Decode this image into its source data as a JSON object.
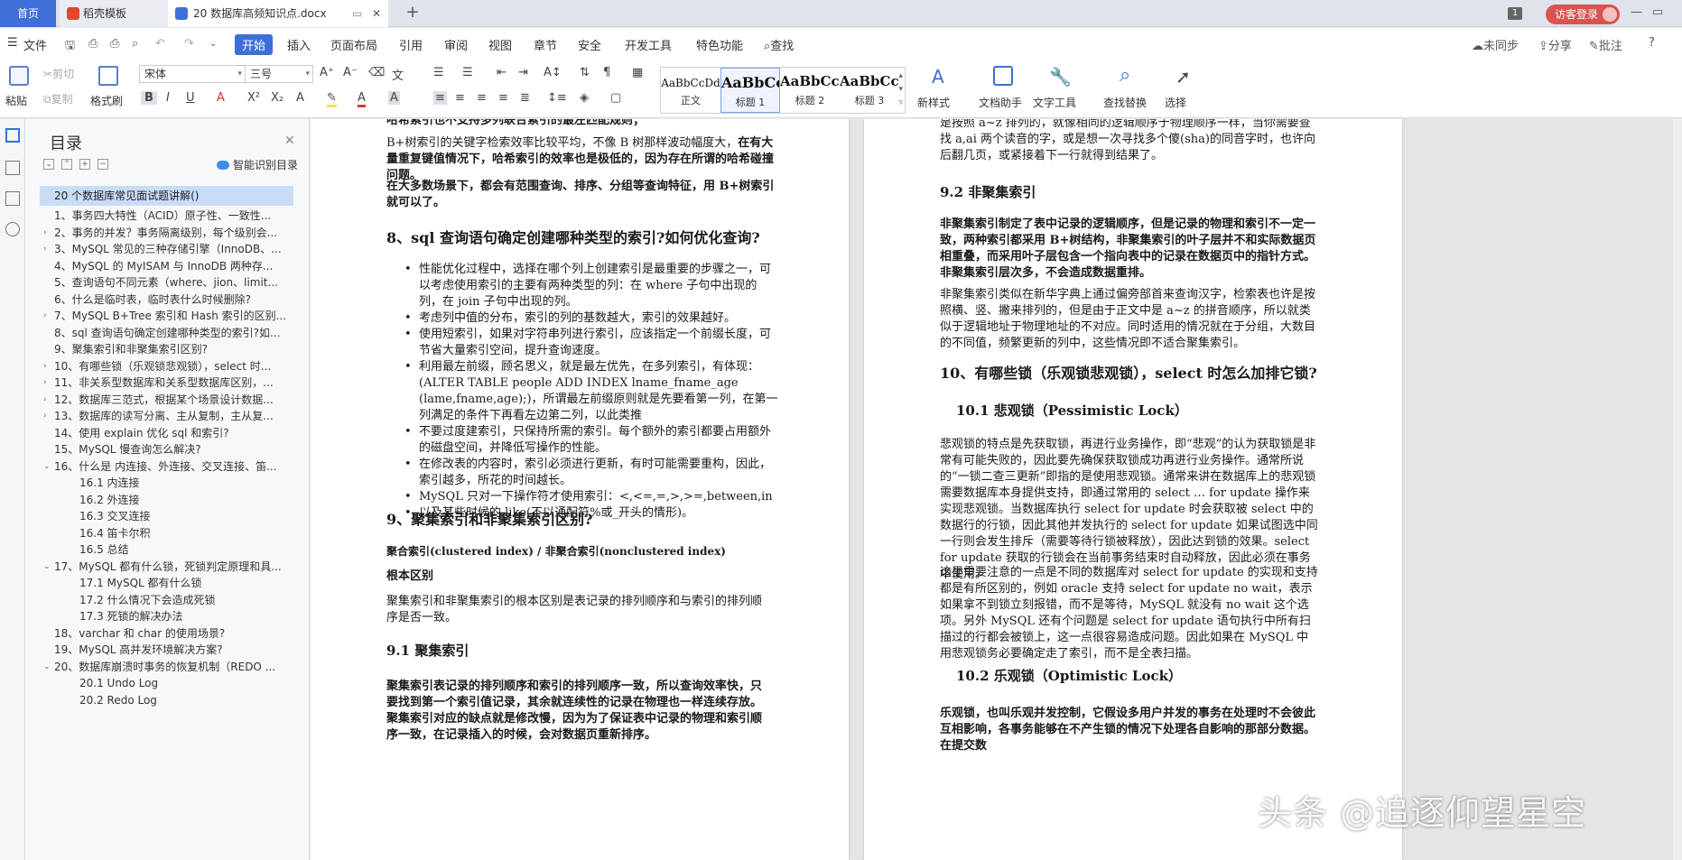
{
  "tabs": {
    "home": "首页",
    "templates": "稻壳模板",
    "document": "20 数据库高频知识点.docx",
    "badge": "1",
    "login": "访客登录"
  },
  "menu": {
    "file": "文件",
    "items": [
      "开始",
      "插入",
      "页面布局",
      "引用",
      "审阅",
      "视图",
      "章节",
      "安全",
      "开发工具",
      "特色功能"
    ],
    "search": "查找",
    "right": [
      "未同步",
      "分享",
      "批注",
      "?"
    ]
  },
  "ribbon": {
    "paste": "粘贴",
    "cut": "剪切",
    "copy": "复制",
    "format_painter": "格式刷",
    "font_name": "宋体",
    "font_size": "三号",
    "styles": [
      {
        "preview": "AaBbCcDd",
        "name": "正文"
      },
      {
        "preview": "AaBbCc",
        "name": "标题 1"
      },
      {
        "preview": "AaBbCcI",
        "name": "标题 2"
      },
      {
        "preview": "AaBbCcI",
        "name": "标题 3"
      }
    ],
    "new_style": "新样式",
    "doc_helper": "文档助手",
    "text_tools": "文字工具",
    "find_replace": "查找替换",
    "select": "选择"
  },
  "nav": {
    "title": "目录",
    "smart": "智能识别目录",
    "selected": "20 个数据库常见面试题讲解()",
    "items": [
      {
        "text": "1、事务四大特性（ACID）原子性、一致性...",
        "level": 1,
        "arrow": ""
      },
      {
        "text": "2、事务的并发？事务隔离级别，每个级别会...",
        "level": 1,
        "arrow": "›"
      },
      {
        "text": "3、MySQL 常见的三种存储引擎（InnoDB、...",
        "level": 1,
        "arrow": "›"
      },
      {
        "text": "4、MySQL 的 MyISAM 与 InnoDB 两种存...",
        "level": 1,
        "arrow": ""
      },
      {
        "text": "5、查询语句不同元素（where、jion、limit...",
        "level": 1,
        "arrow": ""
      },
      {
        "text": "6、什么是临时表，临时表什么时候删除?",
        "level": 1,
        "arrow": ""
      },
      {
        "text": "7、MySQL B+Tree 索引和 Hash 索引的区别...",
        "level": 1,
        "arrow": "›"
      },
      {
        "text": "8、sql 查询语句确定创建哪种类型的索引?如...",
        "level": 1,
        "arrow": ""
      },
      {
        "text": "9、聚集索引和非聚集索引区别?",
        "level": 1,
        "arrow": ""
      },
      {
        "text": "10、有哪些锁（乐观锁悲观锁），select 时...",
        "level": 1,
        "arrow": "›"
      },
      {
        "text": "11、非关系型数据库和关系型数据库区别，...",
        "level": 1,
        "arrow": "›"
      },
      {
        "text": "12、数据库三范式，根据某个场景设计数据...",
        "level": 1,
        "arrow": "›"
      },
      {
        "text": "13、数据库的读写分离、主从复制，主从复...",
        "level": 1,
        "arrow": "›"
      },
      {
        "text": "14、使用 explain 优化 sql 和索引?",
        "level": 1,
        "arrow": ""
      },
      {
        "text": "15、MySQL 慢查询怎么解决?",
        "level": 1,
        "arrow": ""
      },
      {
        "text": "16、什么是 内连接、外连接、交叉连接、笛...",
        "level": 1,
        "arrow": "⌄"
      },
      {
        "text": "16.1 内连接",
        "level": 2,
        "arrow": ""
      },
      {
        "text": "16.2 外连接",
        "level": 2,
        "arrow": ""
      },
      {
        "text": "16.3 交叉连接",
        "level": 2,
        "arrow": ""
      },
      {
        "text": "16.4 笛卡尔积",
        "level": 2,
        "arrow": ""
      },
      {
        "text": "16.5 总结",
        "level": 2,
        "arrow": ""
      },
      {
        "text": "17、MySQL 都有什么锁，死锁判定原理和具...",
        "level": 1,
        "arrow": "⌄"
      },
      {
        "text": "17.1 MySQL 都有什么锁",
        "level": 2,
        "arrow": ""
      },
      {
        "text": "17.2 什么情况下会造成死锁",
        "level": 2,
        "arrow": ""
      },
      {
        "text": "17.3 死锁的解决办法",
        "level": 2,
        "arrow": ""
      },
      {
        "text": "18、varchar 和 char 的使用场景?",
        "level": 1,
        "arrow": ""
      },
      {
        "text": "19、MySQL 高并发环境解决方案?",
        "level": 1,
        "arrow": ""
      },
      {
        "text": "20、数据库崩溃时事务的恢复机制（REDO ...",
        "level": 1,
        "arrow": "⌄"
      },
      {
        "text": "20.1 Undo Log",
        "level": 2,
        "arrow": ""
      },
      {
        "text": "20.2 Redo Log",
        "level": 2,
        "arrow": ""
      }
    ]
  },
  "page1": {
    "cut_top": "哈希索引也不支持多列联合索引的最左匹配规则；",
    "p1_a": "B+树索引的关键字检索效率比较平均，不像 B 树那样波动幅度大，",
    "p1_b": "在有大量重复键值情况下，哈希索引的效率也是极低的，因为存在所谓的哈希碰撞问题。",
    "p2": "在大多数场景下，都会有范围查询、排序、分组等查询特征，用 B+树索引就可以了。",
    "h8": "8、sql 查询语句确定创建哪种类型的索引?如何优化查询?",
    "bullets": [
      "性能优化过程中，选择在哪个列上创建索引是最重要的步骤之一，可以考虑使用索引的主要有两种类型的列：在 where 子句中出现的列，在 join 子句中出现的列。",
      "考虑列中值的分布，索引的列的基数越大，索引的效果越好。",
      "使用短索引，如果对字符串列进行索引，应该指定一个前缀长度，可节省大量索引空间，提升查询速度。",
      "利用最左前缀，顾名思义，就是最左优先，在多列索引，有体现：(ALTER TABLE people ADD INDEX lname_fname_age (lame,fname,age);)，所谓最左前缀原则就是先要看第一列，在第一列满足的条件下再看左边第二列，以此类推",
      "不要过度建索引，只保持所需的索引。每个额外的索引都要占用额外的磁盘空间，并降低写操作的性能。",
      "在修改表的内容时，索引必须进行更新，有时可能需要重构，因此，索引越多，所花的时间越长。",
      "MySQL 只对一下操作符才使用索引：<,<=,=,>,>=,between,in",
      "以及某些时候的 like(不以通配符%或_开头的情形)。"
    ],
    "h9": "9、聚集索引和非聚集索引区别?",
    "p_def": "聚合索引(clustered index) / 非聚合索引(nonclustered index)",
    "p_root": "根本区别",
    "p_root_body": "聚集索引和非聚集索引的根本区别是表记录的排列顺序和与索引的排列顺序是否一致。",
    "h91": "9.1 聚集索引",
    "p_cluster": "聚集索引表记录的排列顺序和索引的排列顺序一致，所以查询效率快，只要找到第一个索引值记录，其余就连续性的记录在物理也一样连续存放。聚集索引对应的缺点就是修改慢，因为为了保证表中记录的物理和索引顺序一致，在记录插入的时候，会对数据页重新排序。"
  },
  "page2": {
    "p_top": "聚集索引类似于新华字典中用拼音去查找汉字，拼音检索表于书记顺序都是按照 a~z 排列的，就像相同的逻辑顺序于物理顺序一样，当你需要查找 a,ai 两个读音的字，或是想一次寻找多个傻(sha)的同音字时，也许向后翻几页，或紧接着下一行就得到结果了。",
    "h92": "9.2 非聚集索引",
    "p_nc1": "非聚集索引制定了表中记录的逻辑顺序，但是记录的物理和索引不一定一致，两种索引都采用 B+树结构，非聚集索引的叶子层并不和实际数据页相重叠，而采用叶子层包含一个指向表中的记录在数据页中的指针方式。非聚集索引层次多，不会造成数据重排。",
    "p_nc2": "非聚集索引类似在新华字典上通过偏旁部首来查询汉字，检索表也许是按照横、竖、撇来排列的，但是由于正文中是 a~z 的拼音顺序，所以就类似于逻辑地址于物理地址的不对应。同时适用的情况就在于分组，大数目的不同值，频繁更新的列中，这些情况即不适合聚集索引。",
    "h10": "10、有哪些锁（乐观锁悲观锁），select 时怎么加排它锁?",
    "h101": "10.1 悲观锁（Pessimistic Lock）",
    "p_pess": "悲观锁的特点是先获取锁，再进行业务操作，即“悲观”的认为获取锁是非常有可能失败的，因此要先确保获取锁成功再进行业务操作。通常所说的“一锁二查三更新”即指的是使用悲观锁。通常来讲在数据库上的悲观锁需要数据库本身提供支持，即通过常用的 select … for update 操作来实现悲观锁。当数据库执行 select for update 时会获取被 select 中的数据行的行锁，因此其他并发执行的 select for update 如果试图选中同一行则会发生排斥（需要等待行锁被释放），因此达到锁的效果。select for update 获取的行锁会在当前事务结束时自动释放，因此必须在事务中使用。",
    "p_note": "这里需要注意的一点是不同的数据库对 select for update 的实现和支持都是有所区别的，例如 oracle 支持 select for update no wait，表示如果拿不到锁立刻报错，而不是等待，MySQL 就没有 no wait 这个选项。另外 MySQL 还有个问题是 select for update 语句执行中所有扫描过的行都会被锁上，这一点很容易造成问题。因此如果在 MySQL 中用悲观锁务必要确定走了索引，而不是全表扫描。",
    "h102": "10.2 乐观锁（Optimistic Lock）",
    "p_opt": "乐观锁，也叫乐观并发控制，它假设多用户并发的事务在处理时不会彼此互相影响，各事务能够在不产生锁的情况下处理各自影响的那部分数据。在提交数"
  },
  "watermark": "头条 @追逐仰望星空"
}
